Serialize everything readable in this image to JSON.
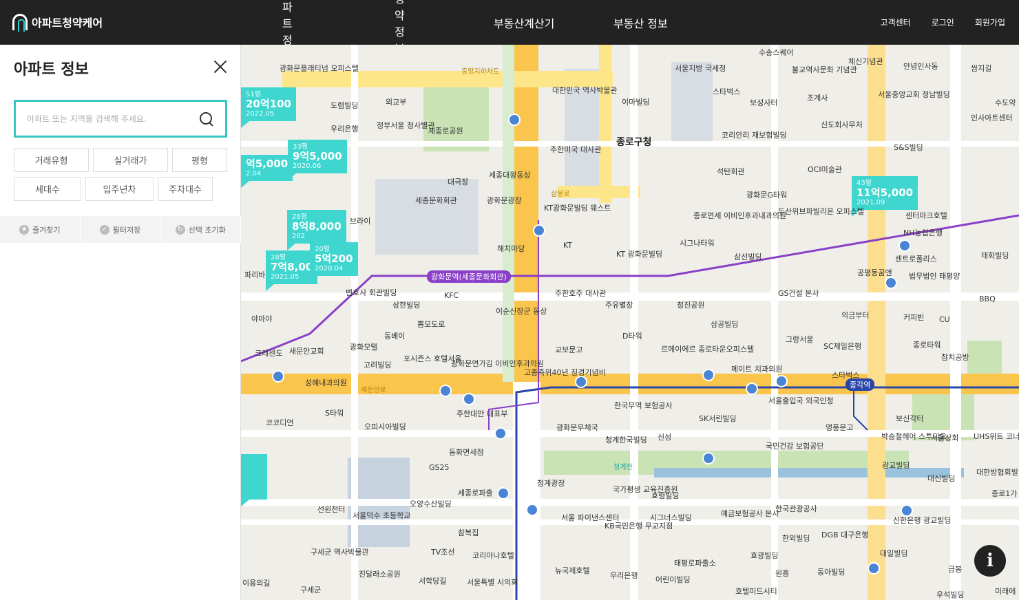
{
  "header": {
    "logo": "아파트청약케어",
    "nav": [
      "아파트 정보",
      "청약정보",
      "부동산계산기",
      "부동산 정보"
    ],
    "util": [
      "고객센터",
      "로그인",
      "회원가입"
    ]
  },
  "sidebar": {
    "title": "아파트 정보",
    "search_placeholder": "아파트 또는 지역을 검색해 주세요.",
    "filters_row1": [
      "거래유형",
      "실거래가",
      "평형"
    ],
    "filters_row2": [
      "세대수",
      "입주년차",
      "주차대수"
    ],
    "actions": [
      "즐겨찾기",
      "필터저장",
      "선택 초기화"
    ]
  },
  "map": {
    "price_pins": [
      {
        "size": "51평",
        "price": "20억100",
        "date": "2022.05"
      },
      {
        "size": "33평",
        "price": "9억5,000",
        "date": "2020.06"
      },
      {
        "size": "",
        "price": "억5,000",
        "date": "2.04"
      },
      {
        "size": "28평",
        "price": "8억8,000",
        "date": "202"
      },
      {
        "size": "28평",
        "price": "7억8,00",
        "date": "2021.05"
      },
      {
        "size": "20평",
        "price": "5억200",
        "date": "2020.04"
      },
      {
        "size": "43평",
        "price": "11억5,000",
        "date": "2021.09"
      }
    ],
    "stations": [
      "광화문역(세종문화회관)",
      "종각역"
    ],
    "labels": [
      "광화문플래티넘 오피스텔",
      "외교부",
      "정부서울 청사별관",
      "세종로공원",
      "도렴빌딩",
      "우리은행",
      "대한민국 역사박물관",
      "이마빌딩",
      "종로구청",
      "서울지방 국세청",
      "수송스퀘어",
      "불교역사문화 기념관",
      "체신기념관",
      "안녕인사동",
      "쌈지길",
      "서울중앙교회 청남빌딩",
      "수도약",
      "인사아트센터",
      "스타벅스",
      "보성사터",
      "조계사",
      "신도회사무처",
      "OCI미술관",
      "S&S빌딩",
      "코리안리 재보험빌딩",
      "석탄회관",
      "대극장",
      "세종문화회관",
      "세종대왕동상",
      "광화문광장",
      "주한미국 대사관",
      "KT광화문빌딩 웨스트",
      "KT",
      "광화문G타워",
      "두산위브파빌리온 오피스텔",
      "종로연세 이비인후과내과의원",
      "시그나타워",
      "센터마크호텔",
      "NH농협은행",
      "센트로폴리스",
      "태화빌딩",
      "해치마당",
      "KT 광화문빌딩",
      "삼선빌딩",
      "공평동꿈앤",
      "법무법인 태평양",
      "BBQ",
      "KFC",
      "이순신장군 동상",
      "주한호주 대사관",
      "주유별장",
      "청진공원",
      "GS건설 본사",
      "의금부터",
      "커피빈",
      "CU",
      "삼한빌딩",
      "뽐모도로",
      "동베이",
      "삼공빌딩",
      "그랑서울",
      "SC제일은행",
      "종로타워",
      "참치공방",
      "광화모텔",
      "포시즌스 호텔서울",
      "광화문연가김 이비인후과의원",
      "고종즉위40년 칭경기념비",
      "교보문고",
      "D타워",
      "르메이에르 종로타운오피스텔",
      "메이트 치과의원",
      "서울출입국 외국인청",
      "스타벅스",
      "고려빌딩",
      "성혜내과의원",
      "새문안로",
      "코코디언",
      "S타워",
      "오피시아빌딩",
      "주한대만 대표부",
      "동화면세점",
      "한국무역 보험공사",
      "광화문우체국",
      "청계한국빌딩",
      "신성",
      "SK서린빌딩",
      "영풍문고",
      "보신각터",
      "박승철헤어 스투디오",
      "서울상회",
      "UHS위트 코너스톤",
      "국민건강 보험공단",
      "광교빌딩",
      "대신빌딩",
      "대한방협회빌딩",
      "GS25",
      "세종로파출",
      "청계광장",
      "청계천",
      "국가평생 교육진흥원",
      "효령빌딩",
      "오양수산빌딩",
      "선원전터",
      "서울덕수 초등학교",
      "서울 파이낸스센터",
      "KB국민은행 무교지점",
      "시그너스빌딩",
      "예금보험공사 본사",
      "한국관광공사",
      "한외빌딩",
      "DGB 대구은행",
      "참복집",
      "TV조선",
      "코리아나호텔",
      "효광빌딩",
      "대일빌딩",
      "구세군 역사박물관",
      "진달래소공원",
      "서학당길",
      "서울특별 시의회",
      "뉴국제호텔",
      "우리은행",
      "태평로파출소",
      "원흥",
      "동아빌딩",
      "어린이빌딩",
      "호텔미드시티",
      "우석빌딩",
      "미래에",
      "금봉",
      "신한은행 광교빌딩",
      "종로1가",
      "구세군",
      "이용의길",
      "파리바",
      "야마야",
      "크레센도",
      "새문안교회",
      "변호사 회관빌딩",
      "브라이",
      "중앙지하차도",
      "삼봉로",
      "종로구청"
    ]
  }
}
